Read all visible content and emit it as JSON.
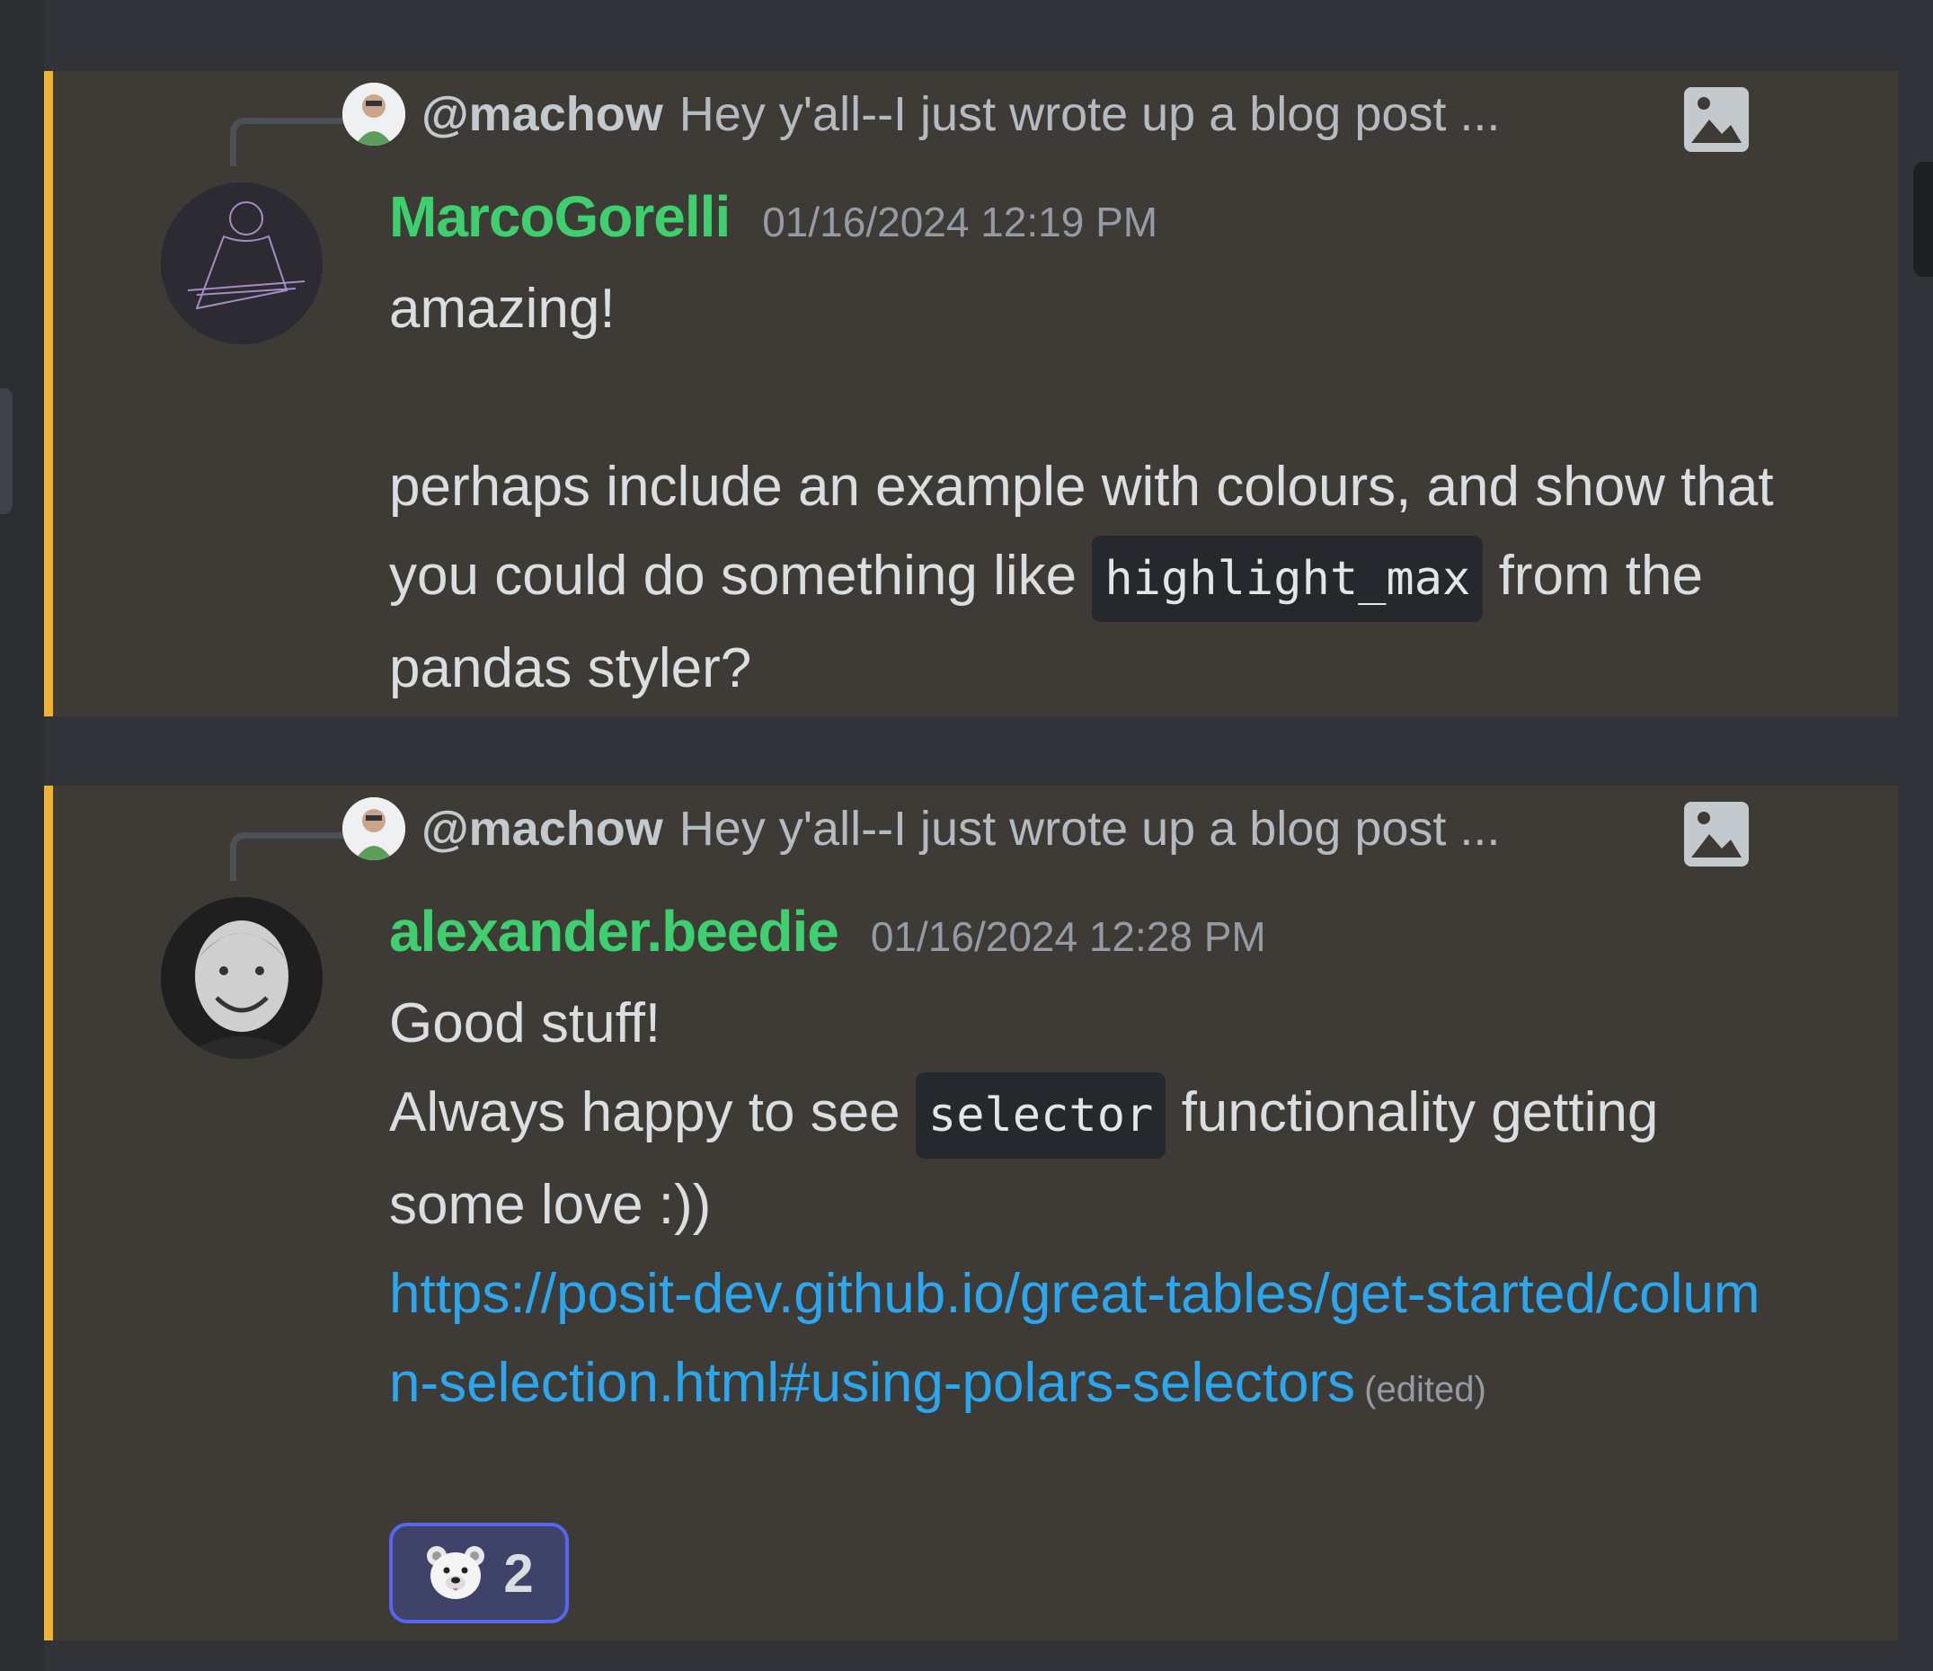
{
  "messages": [
    {
      "reply": {
        "mention": "@machow",
        "preview": "Hey y'all--I just wrote up a blog post ..."
      },
      "username": "MarcoGorelli",
      "timestamp": "01/16/2024 12:19 PM",
      "line1": "amazing!",
      "line2": "perhaps include an example with colours, and show that you could do something like ",
      "code": "highlight_max",
      "line3": " from the pandas styler?"
    },
    {
      "reply": {
        "mention": "@machow",
        "preview": "Hey y'all--I just wrote up a blog post ..."
      },
      "username": "alexander.beedie",
      "timestamp": "01/16/2024 12:28 PM",
      "line1": "Good stuff!",
      "line2_pre": "Always happy to see ",
      "code": "selector",
      "line2_post": " functionality getting some love :))",
      "link": "https://posit-dev.github.io/great-tables/get-started/column-selection.html#using-polars-selectors",
      "edited": "(edited)",
      "reaction": {
        "emoji": "polar-bear-icon",
        "count": "2"
      }
    }
  ],
  "colors": {
    "accent_bar": "#f0b232",
    "username": "#3ecf6e",
    "link": "#2aa7ef",
    "reaction_border": "#5865f2"
  }
}
